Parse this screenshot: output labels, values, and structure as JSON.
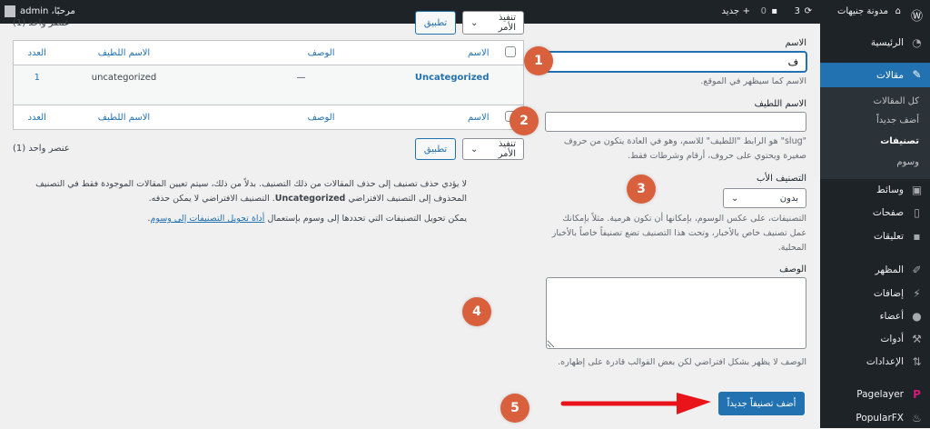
{
  "adminbar": {
    "site_name": "مدونة جنيهات",
    "updates": "3",
    "comments": "0",
    "new": "جديد",
    "greeting": "مرحبًا، admin"
  },
  "sidebar": {
    "items": [
      {
        "label": "الرئيسية",
        "icon": "dashboard-icon"
      },
      {
        "label": "مقالات",
        "icon": "pin-icon"
      },
      {
        "label": "وسائط",
        "icon": "media-icon"
      },
      {
        "label": "صفحات",
        "icon": "pages-icon"
      },
      {
        "label": "تعليقات",
        "icon": "comment-icon"
      },
      {
        "label": "المظهر",
        "icon": "brush-icon"
      },
      {
        "label": "إضافات",
        "icon": "plugin-icon"
      },
      {
        "label": "أعضاء",
        "icon": "user-icon"
      },
      {
        "label": "أدوات",
        "icon": "wrench-icon"
      },
      {
        "label": "الإعدادات",
        "icon": "settings-icon"
      },
      {
        "label": "Pagelayer",
        "icon": "pagelayer-icon"
      },
      {
        "label": "PopularFX",
        "icon": "popularfx-icon"
      }
    ],
    "submenu": [
      "كل المقالات",
      "أضف جديداً",
      "تصنيفات",
      "وسوم"
    ]
  },
  "form": {
    "name_label": "الاسم",
    "name_value": "ف",
    "name_help": "الاسم كما سيظهر في الموقع.",
    "slug_label": "الاسم اللطيف",
    "slug_value": "",
    "slug_help": "\"slug\" هو الرابط \"اللطيف\" للاسم، وهو في العادة يتكون من حروف صغيرة ويحتوي على حروف، أرقام وشرطات فقط.",
    "parent_label": "التصنيف الأب",
    "parent_value": "بدون",
    "parent_help": "التصنيفات، على عكس الوسوم، بإمكانها أن تكون هرمية. مثلاً بإمكانك عمل تصنيف خاص بالأخبار، وتحت هذا التصنيف تضع تصنيفاً خاصاً بالأخبار المحلية.",
    "desc_label": "الوصف",
    "desc_value": "",
    "desc_help": "الوصف لا يظهر بشكل افتراضي لكن بعض القوالب قادرة على إظهاره.",
    "submit": "أضف تصنيفاً جديداً"
  },
  "table": {
    "bulk_action": "تنفيذ الأمر",
    "apply": "تطبيق",
    "count": "عنصر واحد (1)",
    "columns": [
      "الاسم",
      "الوصف",
      "الاسم اللطيف",
      "العدد"
    ],
    "rows": [
      {
        "name": "Uncategorized",
        "description": "—",
        "slug": "uncategorized",
        "count": "1"
      }
    ]
  },
  "notes": {
    "p1a": "لا يؤدي حذف تصنيف إلى حذف المقالات من ذلك التصنيف. بدلاً من ذلك، سيتم تعيين المقالات الموجودة فقط في التصنيف المحذوف إلى التصنيف الافتراضي ",
    "p1b": "Uncategorized",
    "p1c": ". التصنيف الافتراضي لا يمكن حذفه.",
    "p2a": "يمكن تحويل التصنيفات التي تحددها إلى وسوم بإستعمال ",
    "p2link": "أداة تحويل التصنيفات إلى وسوم",
    "p2b": "."
  },
  "annotations": [
    "1",
    "2",
    "3",
    "4",
    "5"
  ],
  "colors": {
    "accent": "#2271b1",
    "annotation": "#d8603c",
    "arrow": "#e8141a"
  }
}
